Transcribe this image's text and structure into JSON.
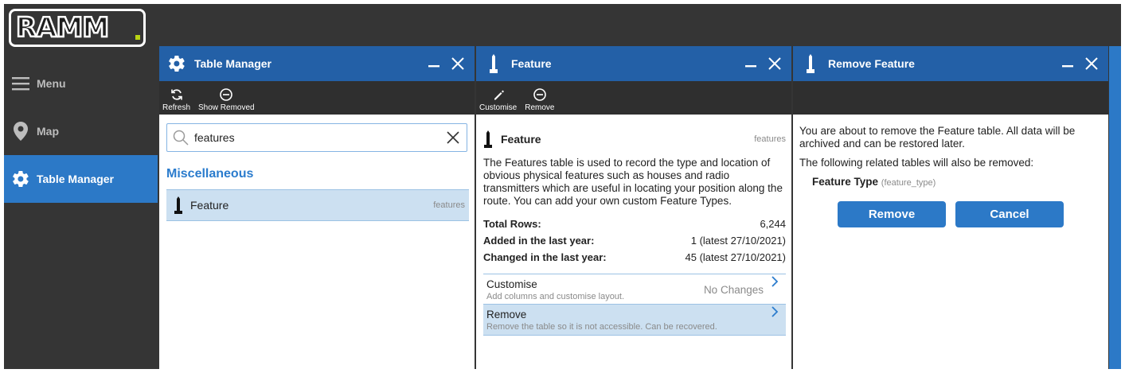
{
  "logo": {
    "text": "RAMM"
  },
  "nav": {
    "items": [
      {
        "label": "Menu",
        "icon": "hamburger-icon"
      },
      {
        "label": "Map",
        "icon": "map-pin-icon"
      },
      {
        "label": "Table Manager",
        "icon": "gear-icon",
        "active": true
      }
    ]
  },
  "table_manager": {
    "title": "Table Manager",
    "toolbar": {
      "refresh": "Refresh",
      "show_removed": "Show Removed"
    },
    "search": {
      "value": "features",
      "placeholder": ""
    },
    "section": "Miscellaneous",
    "row": {
      "label": "Feature",
      "code": "features"
    }
  },
  "feature": {
    "title": "Feature",
    "toolbar": {
      "customise": "Customise",
      "remove": "Remove"
    },
    "name": "Feature",
    "code": "features",
    "description": "The Features table is used to record the type and location of obvious physical features such as houses and radio transmitters which are useful in locating your position along the route. You can add your own custom Feature Types.",
    "stats": [
      {
        "label": "Total Rows:",
        "value": "6,244"
      },
      {
        "label": "Added in the last year:",
        "value": "1 (latest 27/10/2021)"
      },
      {
        "label": "Changed in the last year:",
        "value": "45 (latest 27/10/2021)"
      }
    ],
    "customise": {
      "title": "Customise",
      "subtitle": "Add columns and customise layout.",
      "status": "No Changes"
    },
    "remove": {
      "title": "Remove",
      "subtitle": "Remove the table so it is not accessible. Can be recovered."
    }
  },
  "remove_feature": {
    "title": "Remove Feature",
    "message": "You are about to remove the Feature table. All data will be archived and can be restored later.",
    "related_intro": "The following related tables will also be removed:",
    "related": {
      "name": "Feature Type",
      "code": "(feature_type)"
    },
    "remove_button": "Remove",
    "cancel_button": "Cancel"
  },
  "colors": {
    "accent": "#2c79c7",
    "header": "#2360a7",
    "sidebar": "#353535",
    "selection": "#cce0f1"
  }
}
